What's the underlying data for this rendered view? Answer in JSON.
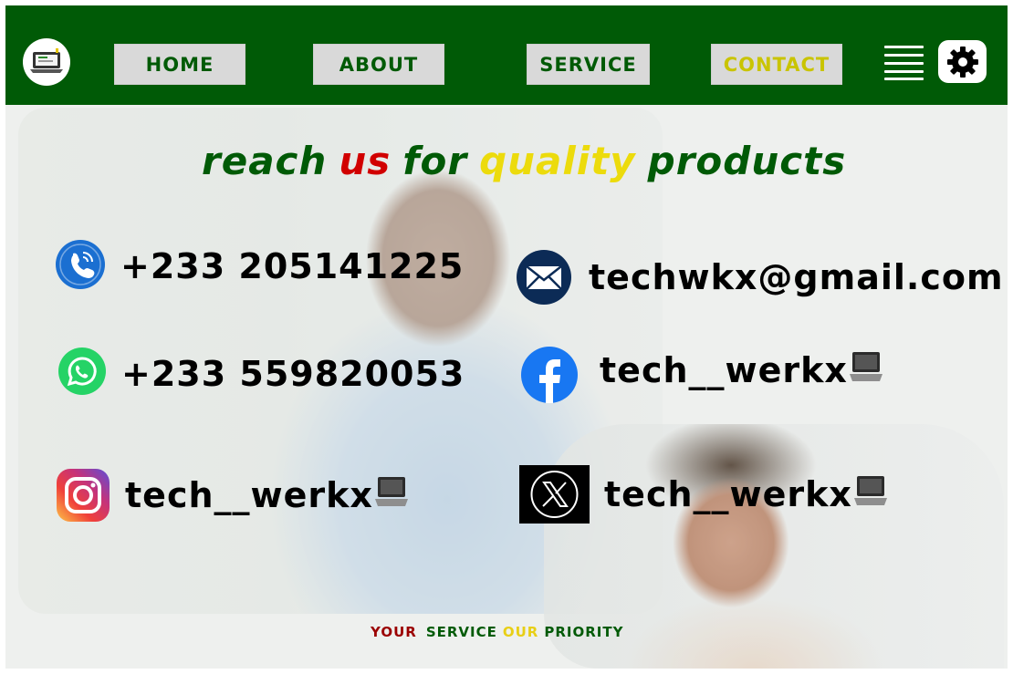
{
  "nav": {
    "items": [
      {
        "label": "HOME"
      },
      {
        "label": "ABOUT"
      },
      {
        "label": "SERVICE"
      },
      {
        "label": "CONTACT"
      }
    ],
    "active": "CONTACT"
  },
  "headline": {
    "parts": [
      "reach",
      "us",
      "for",
      "quality",
      "products"
    ]
  },
  "contacts": {
    "phone": "+233 205141225",
    "whatsapp": "+233 559820053",
    "email": "techwkx@gmail.com",
    "facebook": "tech__werkx",
    "instagram": "tech__werkx",
    "x": "tech__werkx"
  },
  "tagline": {
    "parts": [
      "YOUR",
      "SERVICE",
      "OUR",
      "PRIORITY"
    ]
  },
  "colors": {
    "brand_green": "#005a06",
    "accent_red": "#d10000",
    "accent_yellow": "#ecdb0c",
    "nav_button_bg": "#d9d9d9"
  },
  "icons": [
    "logo-icon",
    "menu-icon",
    "gear-icon",
    "phone-icon",
    "whatsapp-icon",
    "mail-icon",
    "facebook-icon",
    "instagram-icon",
    "x-icon",
    "laptop-icon"
  ]
}
